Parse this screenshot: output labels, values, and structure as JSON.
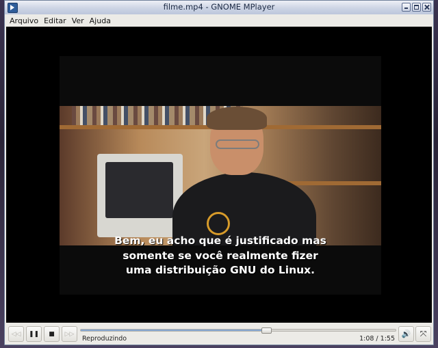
{
  "window": {
    "title": "filme.mp4 - GNOME MPlayer"
  },
  "menu": [
    "Arquivo",
    "Editar",
    "Ver",
    "Ajuda"
  ],
  "subtitles": [
    "Bem, eu acho que é justificado mas",
    "somente se você realmente fizer",
    "uma distribuição GNU do Linux."
  ],
  "controls": {
    "rewind_icon": "◁◁",
    "play_pause_icon": "❚❚",
    "stop_icon": "■",
    "forward_icon": "▷▷",
    "volume_icon": "🔊",
    "fullscreen_icon": "⤧",
    "status": "Reproduzindo",
    "time": "1:08 / 1:55",
    "progress": 0.59
  },
  "colors": {
    "accent": "#86a7d1",
    "video_bg": "#000000"
  }
}
